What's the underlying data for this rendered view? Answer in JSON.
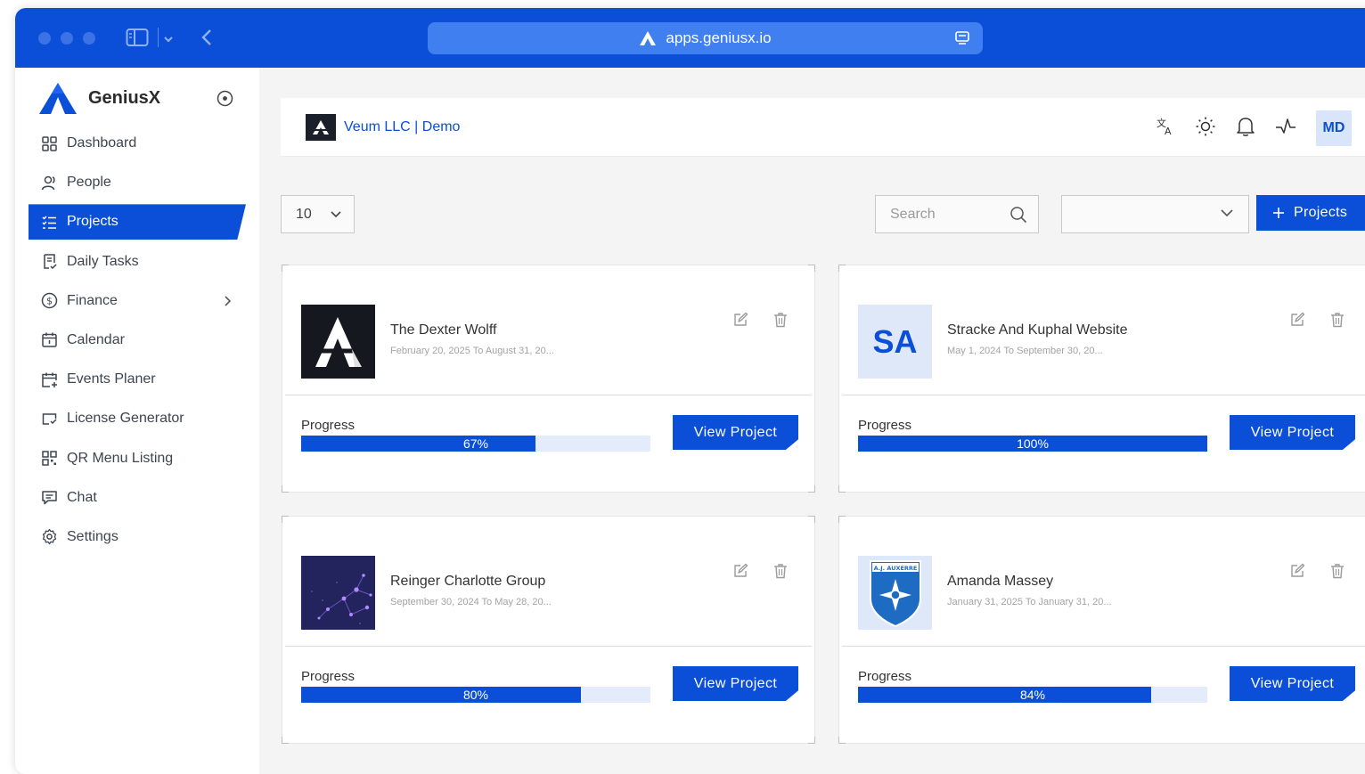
{
  "browser": {
    "url": "apps.geniusx.io"
  },
  "app": {
    "name": "GeniusX"
  },
  "sidebar": {
    "items": [
      {
        "label": "Dashboard",
        "icon": "dashboard-icon"
      },
      {
        "label": "People",
        "icon": "people-icon"
      },
      {
        "label": "Projects",
        "icon": "projects-icon",
        "active": true
      },
      {
        "label": "Daily Tasks",
        "icon": "daily-tasks-icon"
      },
      {
        "label": "Finance",
        "icon": "finance-icon",
        "has_submenu": true
      },
      {
        "label": "Calendar",
        "icon": "calendar-icon"
      },
      {
        "label": "Events Planer",
        "icon": "events-icon"
      },
      {
        "label": "License Generator",
        "icon": "license-icon"
      },
      {
        "label": "QR Menu Listing",
        "icon": "qr-icon"
      },
      {
        "label": "Chat",
        "icon": "chat-icon"
      },
      {
        "label": "Settings",
        "icon": "settings-icon"
      }
    ]
  },
  "header": {
    "org_name": "Veum LLC | Demo",
    "avatar_initials": "MD"
  },
  "toolbar": {
    "per_page": "10",
    "search_placeholder": "Search",
    "filter_value": "",
    "add_button": "Projects"
  },
  "projects": [
    {
      "name": "The Dexter Wolff",
      "dates": "February 20, 2025  To  August 31, 20...",
      "progress_label": "Progress",
      "progress": 67,
      "progress_text": "67%",
      "thumb": "dexter-logo",
      "view_label": "View Project"
    },
    {
      "name": "Stracke And Kuphal Website",
      "dates": "May 1, 2024  To  September 30, 20...",
      "progress_label": "Progress",
      "progress": 100,
      "progress_text": "100%",
      "thumb_initials": "SA",
      "view_label": "View Project"
    },
    {
      "name": "Reinger Charlotte Group",
      "dates": "September 30, 2024  To  May 28, 20...",
      "progress_label": "Progress",
      "progress": 80,
      "progress_text": "80%",
      "thumb": "network-image",
      "view_label": "View Project"
    },
    {
      "name": "Amanda Massey",
      "dates": "January 31, 2025  To  January 31, 20...",
      "progress_label": "Progress",
      "progress": 84,
      "progress_text": "84%",
      "thumb": "auxerre-crest",
      "thumb_text": "A.J. AUXERRE",
      "view_label": "View Project"
    }
  ],
  "colors": {
    "accent": "#0b4fd8",
    "titlebar": "#0b4fd8",
    "track": "#e4ecfb"
  }
}
